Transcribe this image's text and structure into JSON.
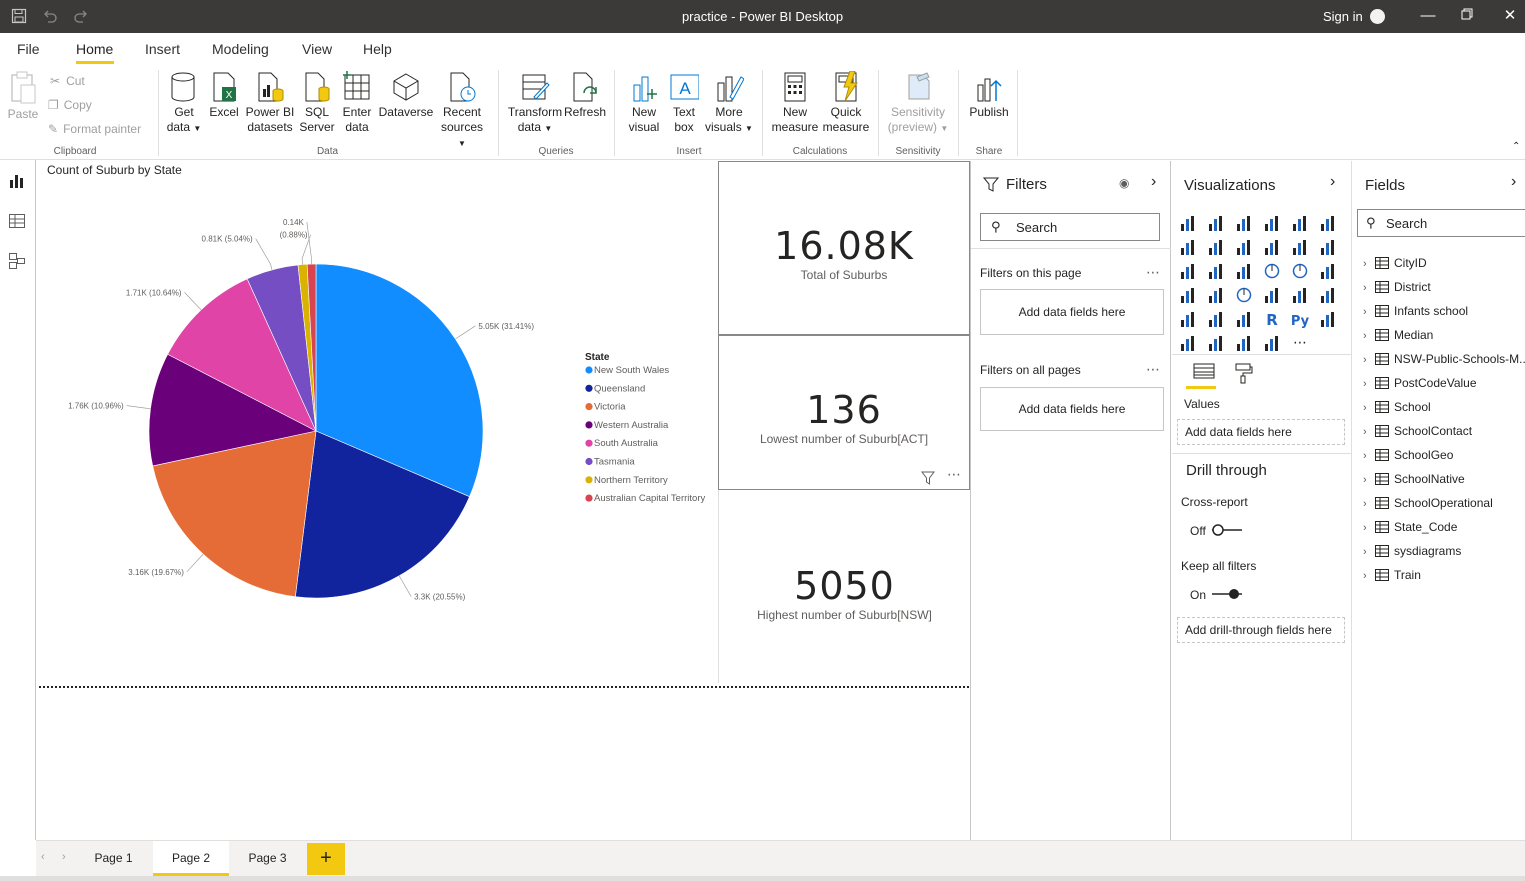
{
  "window": {
    "title": "practice - Power BI Desktop",
    "sign_in": "Sign in"
  },
  "menu": {
    "items": [
      "File",
      "Home",
      "Insert",
      "Modeling",
      "View",
      "Help"
    ],
    "active": "Home"
  },
  "ribbon": {
    "clipboard": {
      "paste": "Paste",
      "cut": "Cut",
      "copy": "Copy",
      "format_painter": "Format painter",
      "label": "Clipboard"
    },
    "data": {
      "get_data": [
        "Get",
        "data"
      ],
      "excel": "Excel",
      "power_bi_datasets": [
        "Power BI",
        "datasets"
      ],
      "sql_server": [
        "SQL",
        "Server"
      ],
      "enter_data": [
        "Enter",
        "data"
      ],
      "dataverse": "Dataverse",
      "recent_sources": [
        "Recent",
        "sources"
      ],
      "label": "Data"
    },
    "queries": {
      "transform_data": [
        "Transform",
        "data"
      ],
      "refresh": "Refresh",
      "label": "Queries"
    },
    "insert": {
      "new_visual": [
        "New",
        "visual"
      ],
      "text_box": [
        "Text",
        "box"
      ],
      "more_visuals": [
        "More",
        "visuals"
      ],
      "label": "Insert"
    },
    "calculations": {
      "new_measure": [
        "New",
        "measure"
      ],
      "quick_measure": [
        "Quick",
        "measure"
      ],
      "label": "Calculations"
    },
    "sensitivity": {
      "sensitivity": [
        "Sensitivity",
        "(preview)"
      ],
      "label": "Sensitivity"
    },
    "share": {
      "publish": "Publish",
      "label": "Share"
    }
  },
  "pie_visual": {
    "title": "Count of Suburb by State",
    "legend_title": "State"
  },
  "chart_data": {
    "type": "pie",
    "title": "Count of Suburb by State",
    "legend_title": "State",
    "legend_placement": "right",
    "categories": [
      "New South Wales",
      "Queensland",
      "Victoria",
      "Western Australia",
      "South Australia",
      "Tasmania",
      "Northern Territory",
      "Australian Capital Territory"
    ],
    "values": [
      5050,
      3300,
      3160,
      1760,
      1710,
      810,
      140,
      136
    ],
    "percents": [
      31.41,
      20.55,
      19.67,
      10.96,
      10.64,
      5.04,
      0.88,
      0.85
    ],
    "data_labels": [
      "5.05K (31.41%)",
      "3.3K (20.55%)",
      "3.16K (19.67%)",
      "1.76K (10.96%)",
      "1.71K (10.64%)",
      "0.81K (5.04%)",
      "(0.88%)",
      "0.14K"
    ],
    "colors": [
      "#118dff",
      "#12239e",
      "#e66c37",
      "#6b007b",
      "#e044a7",
      "#744ec2",
      "#d9b300",
      "#d64550"
    ]
  },
  "cards": [
    {
      "value": "16.08K",
      "label": "Total of Suburbs"
    },
    {
      "value": "136",
      "label": "Lowest number of Suburb[ACT]"
    },
    {
      "value": "5050",
      "label": "Highest number of Suburb[NSW]"
    }
  ],
  "filters": {
    "title": "Filters",
    "search_placeholder": "Search",
    "on_this_page": "Filters on this page",
    "on_all_pages": "Filters on all pages",
    "add_fields": "Add data fields here"
  },
  "visualizations": {
    "title": "Visualizations",
    "values_label": "Values",
    "add_data_fields": "Add data fields here",
    "drill_through": "Drill through",
    "cross_report": "Cross-report",
    "cross_report_state": "Off",
    "keep_all_filters": "Keep all filters",
    "keep_all_filters_state": "On",
    "add_drill_fields": "Add drill-through fields here"
  },
  "fields": {
    "title": "Fields",
    "search_placeholder": "Search",
    "tables": [
      "CityID",
      "District",
      "Infants school",
      "Median",
      "NSW-Public-Schools-M...",
      "PostCodeValue",
      "School",
      "SchoolContact",
      "SchoolGeo",
      "SchoolNative",
      "SchoolOperational",
      "State_Code",
      "sysdiagrams",
      "Train"
    ]
  },
  "pages": {
    "tabs": [
      "Page 1",
      "Page 2",
      "Page 3"
    ],
    "active": "Page 2",
    "add": "+"
  }
}
